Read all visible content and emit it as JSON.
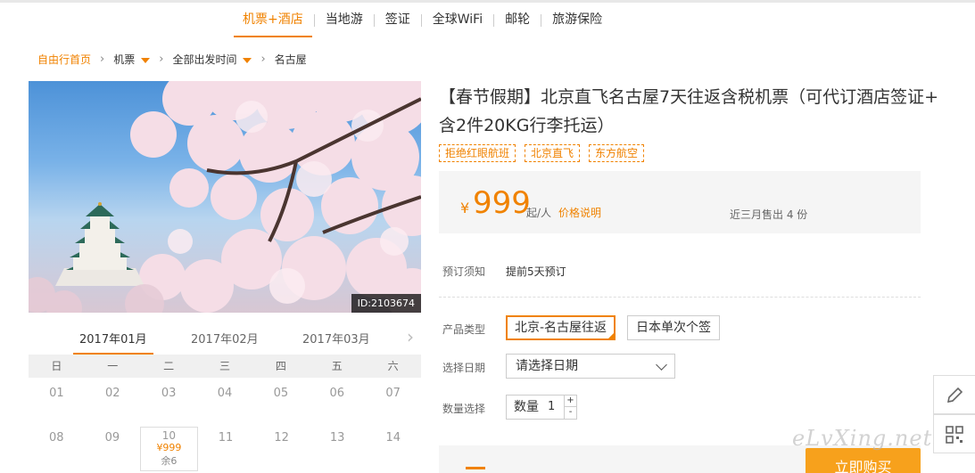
{
  "nav": {
    "tabs": [
      {
        "label": "机票+酒店",
        "active": true
      },
      {
        "label": "当地游",
        "active": false
      },
      {
        "label": "签证",
        "active": false
      },
      {
        "label": "全球WiFi",
        "active": false
      },
      {
        "label": "邮轮",
        "active": false
      },
      {
        "label": "旅游保险",
        "active": false
      }
    ]
  },
  "breadcrumb": {
    "home": "自由行首页",
    "items": [
      "机票",
      "全部出发时间",
      "名古屋"
    ]
  },
  "photo": {
    "id_label": "ID:2103674"
  },
  "calendar": {
    "months": [
      "2017年01月",
      "2017年02月",
      "2017年03月"
    ],
    "active_month": 0,
    "weekdays": [
      "日",
      "一",
      "二",
      "三",
      "四",
      "五",
      "六"
    ],
    "weeks": [
      [
        "01",
        "02",
        "03",
        "04",
        "05",
        "06",
        "07"
      ],
      [
        "08",
        "09",
        "10",
        "11",
        "12",
        "13",
        "14"
      ]
    ],
    "available": {
      "day": "10",
      "price": "¥999",
      "remain": "余6"
    }
  },
  "product": {
    "title": "【春节假期】北京直飞名古屋7天往返含税机票（可代订酒店签证+ 含2件20KG行李托运）",
    "tags": [
      "拒绝红眼航班",
      "北京直飞",
      "东方航空"
    ],
    "price": {
      "currency": "¥",
      "amount": "999",
      "unit": "起/人",
      "desc_link": "价格说明",
      "sold": "近三月售出 4 份"
    },
    "booking_note_label": "预订须知",
    "booking_note_value": "提前5天预订",
    "type_label": "产品类型",
    "type_options": [
      "北京-名古屋往返",
      "日本单次个签"
    ],
    "date_label": "选择日期",
    "date_placeholder": "请选择日期",
    "qty_label": "数量选择",
    "qty_prefix": "数量",
    "qty_value": "1",
    "qty_plus": "+",
    "qty_minus": "-",
    "buy_label": "立即购买"
  },
  "watermark": "eLvXing.net",
  "colors": {
    "accent": "#f08200",
    "buy": "#f7a11c"
  }
}
